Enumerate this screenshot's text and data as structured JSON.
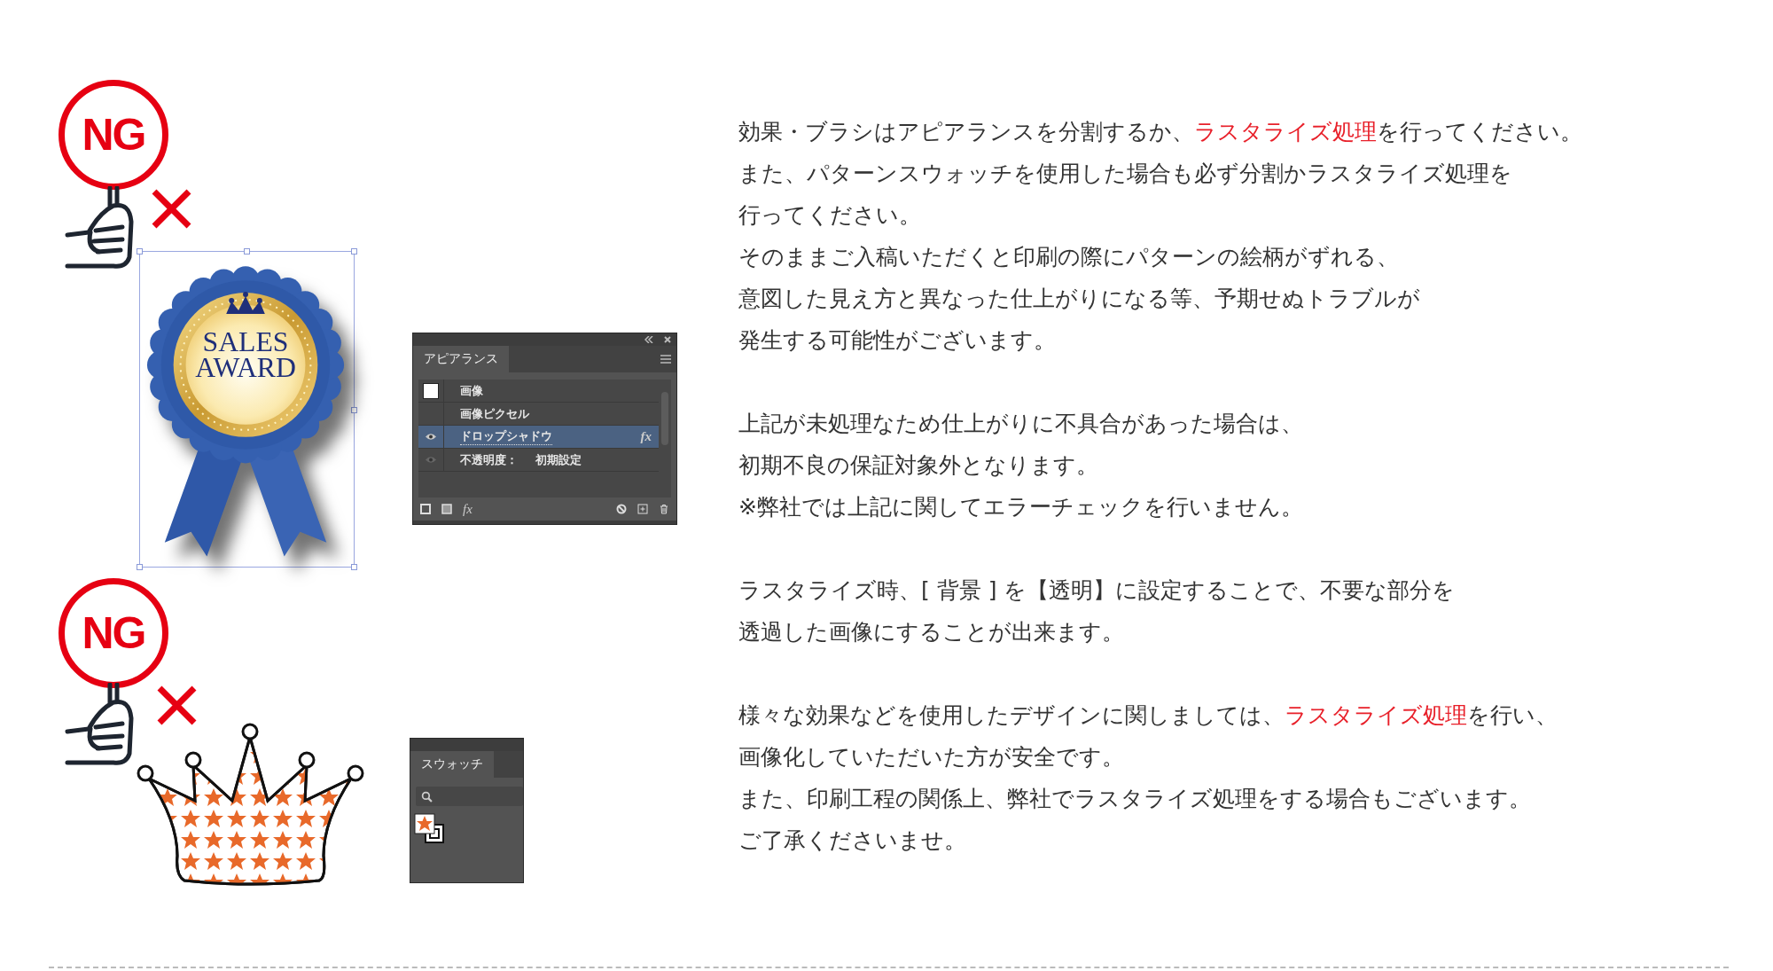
{
  "examples": [
    {
      "kind": "award",
      "badge": "NG",
      "award_lines": [
        "SALES",
        "AWARD"
      ],
      "panel": {
        "kind": "appearance",
        "tab": "アピアランス",
        "footer_fx": "fx",
        "rows": [
          {
            "kind": "fill",
            "label": "画像",
            "selected": false
          },
          {
            "kind": "plain",
            "label": "画像ピクセル",
            "selected": false
          },
          {
            "kind": "effect",
            "label": "ドロップシャドウ",
            "fx": "fx",
            "visible": true,
            "selected": true
          },
          {
            "kind": "opacity",
            "label": "不透明度：",
            "value": "初期設定",
            "visible": false,
            "selected": false
          }
        ]
      }
    },
    {
      "kind": "crown",
      "badge": "NG",
      "panel": {
        "kind": "swatches",
        "tab": "スウォッチ"
      }
    }
  ],
  "paragraphs": [
    [
      [
        {
          "text": "効果・ブラシはアピアランスを分割するか、",
          "highlight": false
        },
        {
          "text": "ラスタライズ処理",
          "highlight": true
        },
        {
          "text": "を行ってください。",
          "highlight": false
        }
      ],
      [
        {
          "text": "また、パターンスウォッチを使用した場合も必ず分割かラスタライズ処理を",
          "highlight": false
        }
      ],
      [
        {
          "text": "行ってください。",
          "highlight": false
        }
      ],
      [
        {
          "text": "そのままご入稿いただくと印刷の際にパターンの絵柄がずれる、",
          "highlight": false
        }
      ],
      [
        {
          "text": "意図した見え方と異なった仕上がりになる等、予期せぬトラブルが",
          "highlight": false
        }
      ],
      [
        {
          "text": "発生する可能性がございます。",
          "highlight": false
        }
      ]
    ],
    [
      [
        {
          "text": "上記が未処理なため仕上がりに不具合があった場合は、",
          "highlight": false
        }
      ],
      [
        {
          "text": "初期不良の保証対象外となります。",
          "highlight": false
        }
      ],
      [
        {
          "text": "※弊社では上記に関してエラーチェックを行いません。",
          "highlight": false
        }
      ]
    ],
    [
      [
        {
          "text": "ラスタライズ時、[ 背景 ] を【透明】に設定することで、不要な部分を",
          "highlight": false
        }
      ],
      [
        {
          "text": "透過した画像にすることが出来ます。",
          "highlight": false
        }
      ]
    ],
    [
      [
        {
          "text": "様々な効果などを使用したデザインに関しましては、",
          "highlight": false
        },
        {
          "text": "ラスタライズ処理",
          "highlight": true
        },
        {
          "text": "を行い、",
          "highlight": false
        }
      ],
      [
        {
          "text": "画像化していただいた方が安全です。",
          "highlight": false
        }
      ],
      [
        {
          "text": "また、印刷工程の関係上、弊社でラスタライズ処理をする場合もございます。",
          "highlight": false
        }
      ],
      [
        {
          "text": "ご了承くださいませ。",
          "highlight": false
        }
      ]
    ]
  ]
}
